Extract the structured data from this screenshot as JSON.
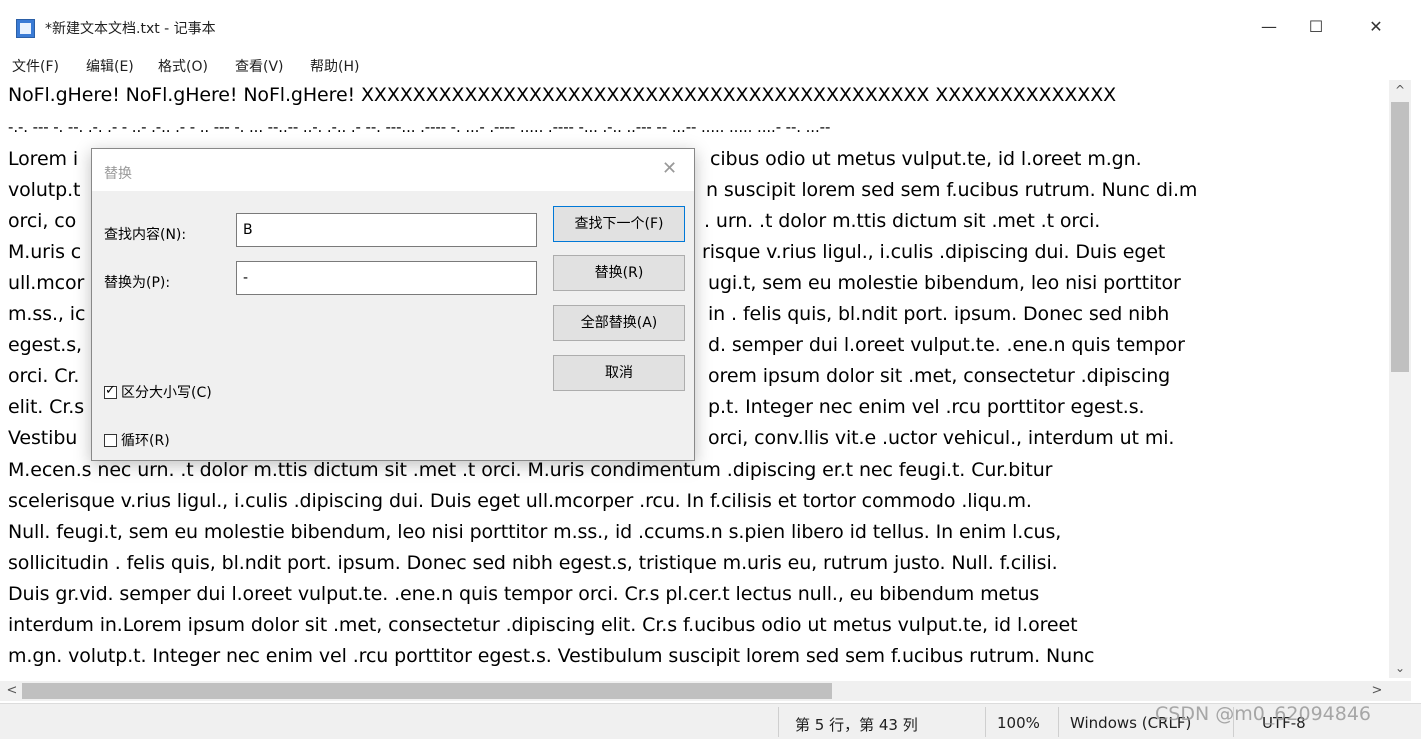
{
  "window": {
    "title": "*新建文本文档.txt - 记事本",
    "controls": {
      "minimize": "—",
      "maximize": "☐",
      "close": "✕"
    }
  },
  "menu": [
    "文件(F)",
    "编辑(E)",
    "格式(O)",
    "查看(V)",
    "帮助(H)"
  ],
  "editor": {
    "lines": [
      "NoFl.gHere! NoFl.gHere! NoFl.gHere! XXXXXXXXXXXXXXXXXXXXXXXXXXXXXXXXXXXXXXXXXXXX XXXXXXXXXXXXXX",
      "-.-. --- -. --. .-. .- - ..- .-.. .- - .. --- -. ... --..-- ..-. .-.. .- --. ---... .---- -. ...- .---- ..... .---- -... .-.. ..--- -- ...-- ..... ..... ....- --. ...--",
      "Lorem i",
      "volutp.t",
      "orci, co",
      "M.uris c",
      "ull.mcor",
      "m.ss., ic",
      "egest.s,",
      "orci. Cr.",
      "elit. Cr.s",
      "Vestibu",
      "M.ecen.s nec urn. .t dolor m.ttis dictum sit .met .t orci. M.uris condimentum .dipiscing er.t nec feugi.t. Cur.bitur",
      "scelerisque v.rius ligul., i.culis .dipiscing dui. Duis eget ull.mcorper .rcu. In f.cilisis et tortor commodo .liqu.m.",
      "Null. feugi.t, sem eu molestie bibendum, leo nisi porttitor m.ss., id .ccums.n s.pien libero id tellus. In enim l.cus,",
      "sollicitudin . felis quis, bl.ndit port. ipsum. Donec sed nibh egest.s, tristique m.uris eu, rutrum justo. Null. f.cilisi.",
      "Duis gr.vid. semper dui l.oreet vulput.te. .ene.n quis tempor orci. Cr.s pl.cer.t lectus null., eu bibendum metus",
      "interdum in.Lorem ipsum dolor sit .met, consectetur .dipiscing elit. Cr.s f.ucibus odio ut metus vulput.te, id l.oreet",
      "m.gn. volutp.t. Integer nec enim vel .rcu porttitor egest.s. Vestibulum suscipit lorem sed sem f.ucibus rutrum. Nunc"
    ],
    "right_fragments": [
      "cibus odio ut metus vulput.te, id l.oreet m.gn.",
      "n suscipit lorem sed sem f.ucibus rutrum. Nunc di.m",
      ". urn. .t dolor m.ttis dictum sit .met .t orci.",
      "risque v.rius ligul., i.culis .dipiscing dui. Duis eget",
      "ugi.t, sem eu molestie bibendum, leo nisi porttitor",
      "in . felis quis, bl.ndit port. ipsum. Donec sed nibh",
      "d. semper dui l.oreet vulput.te. .ene.n quis tempor",
      "orem ipsum dolor sit .met, consectetur .dipiscing",
      "p.t. Integer nec enim vel .rcu porttitor egest.s.",
      " orci, conv.llis vit.e .uctor vehicul., interdum ut mi."
    ]
  },
  "scrollbar": {
    "up": "^",
    "down": "⌄",
    "left": "<",
    "right": ">"
  },
  "status": {
    "position": "第 5 行，第 43 列",
    "zoom": "100%",
    "line_ending": "Windows (CRLF)",
    "encoding": "UTF-8"
  },
  "watermark": "CSDN @m0_62094846",
  "dialog": {
    "title": "替换",
    "close": "✕",
    "find_label": "查找内容(N):",
    "find_value": "B",
    "replace_label": "替换为(P):",
    "replace_value": "-",
    "buttons": {
      "find_next": "查找下一个(F)",
      "replace": "替换(R)",
      "replace_all": "全部替换(A)",
      "cancel": "取消"
    },
    "match_case": {
      "label": "区分大小写(C)",
      "checked": true
    },
    "wrap": {
      "label": "循环(R)",
      "checked": false
    }
  }
}
